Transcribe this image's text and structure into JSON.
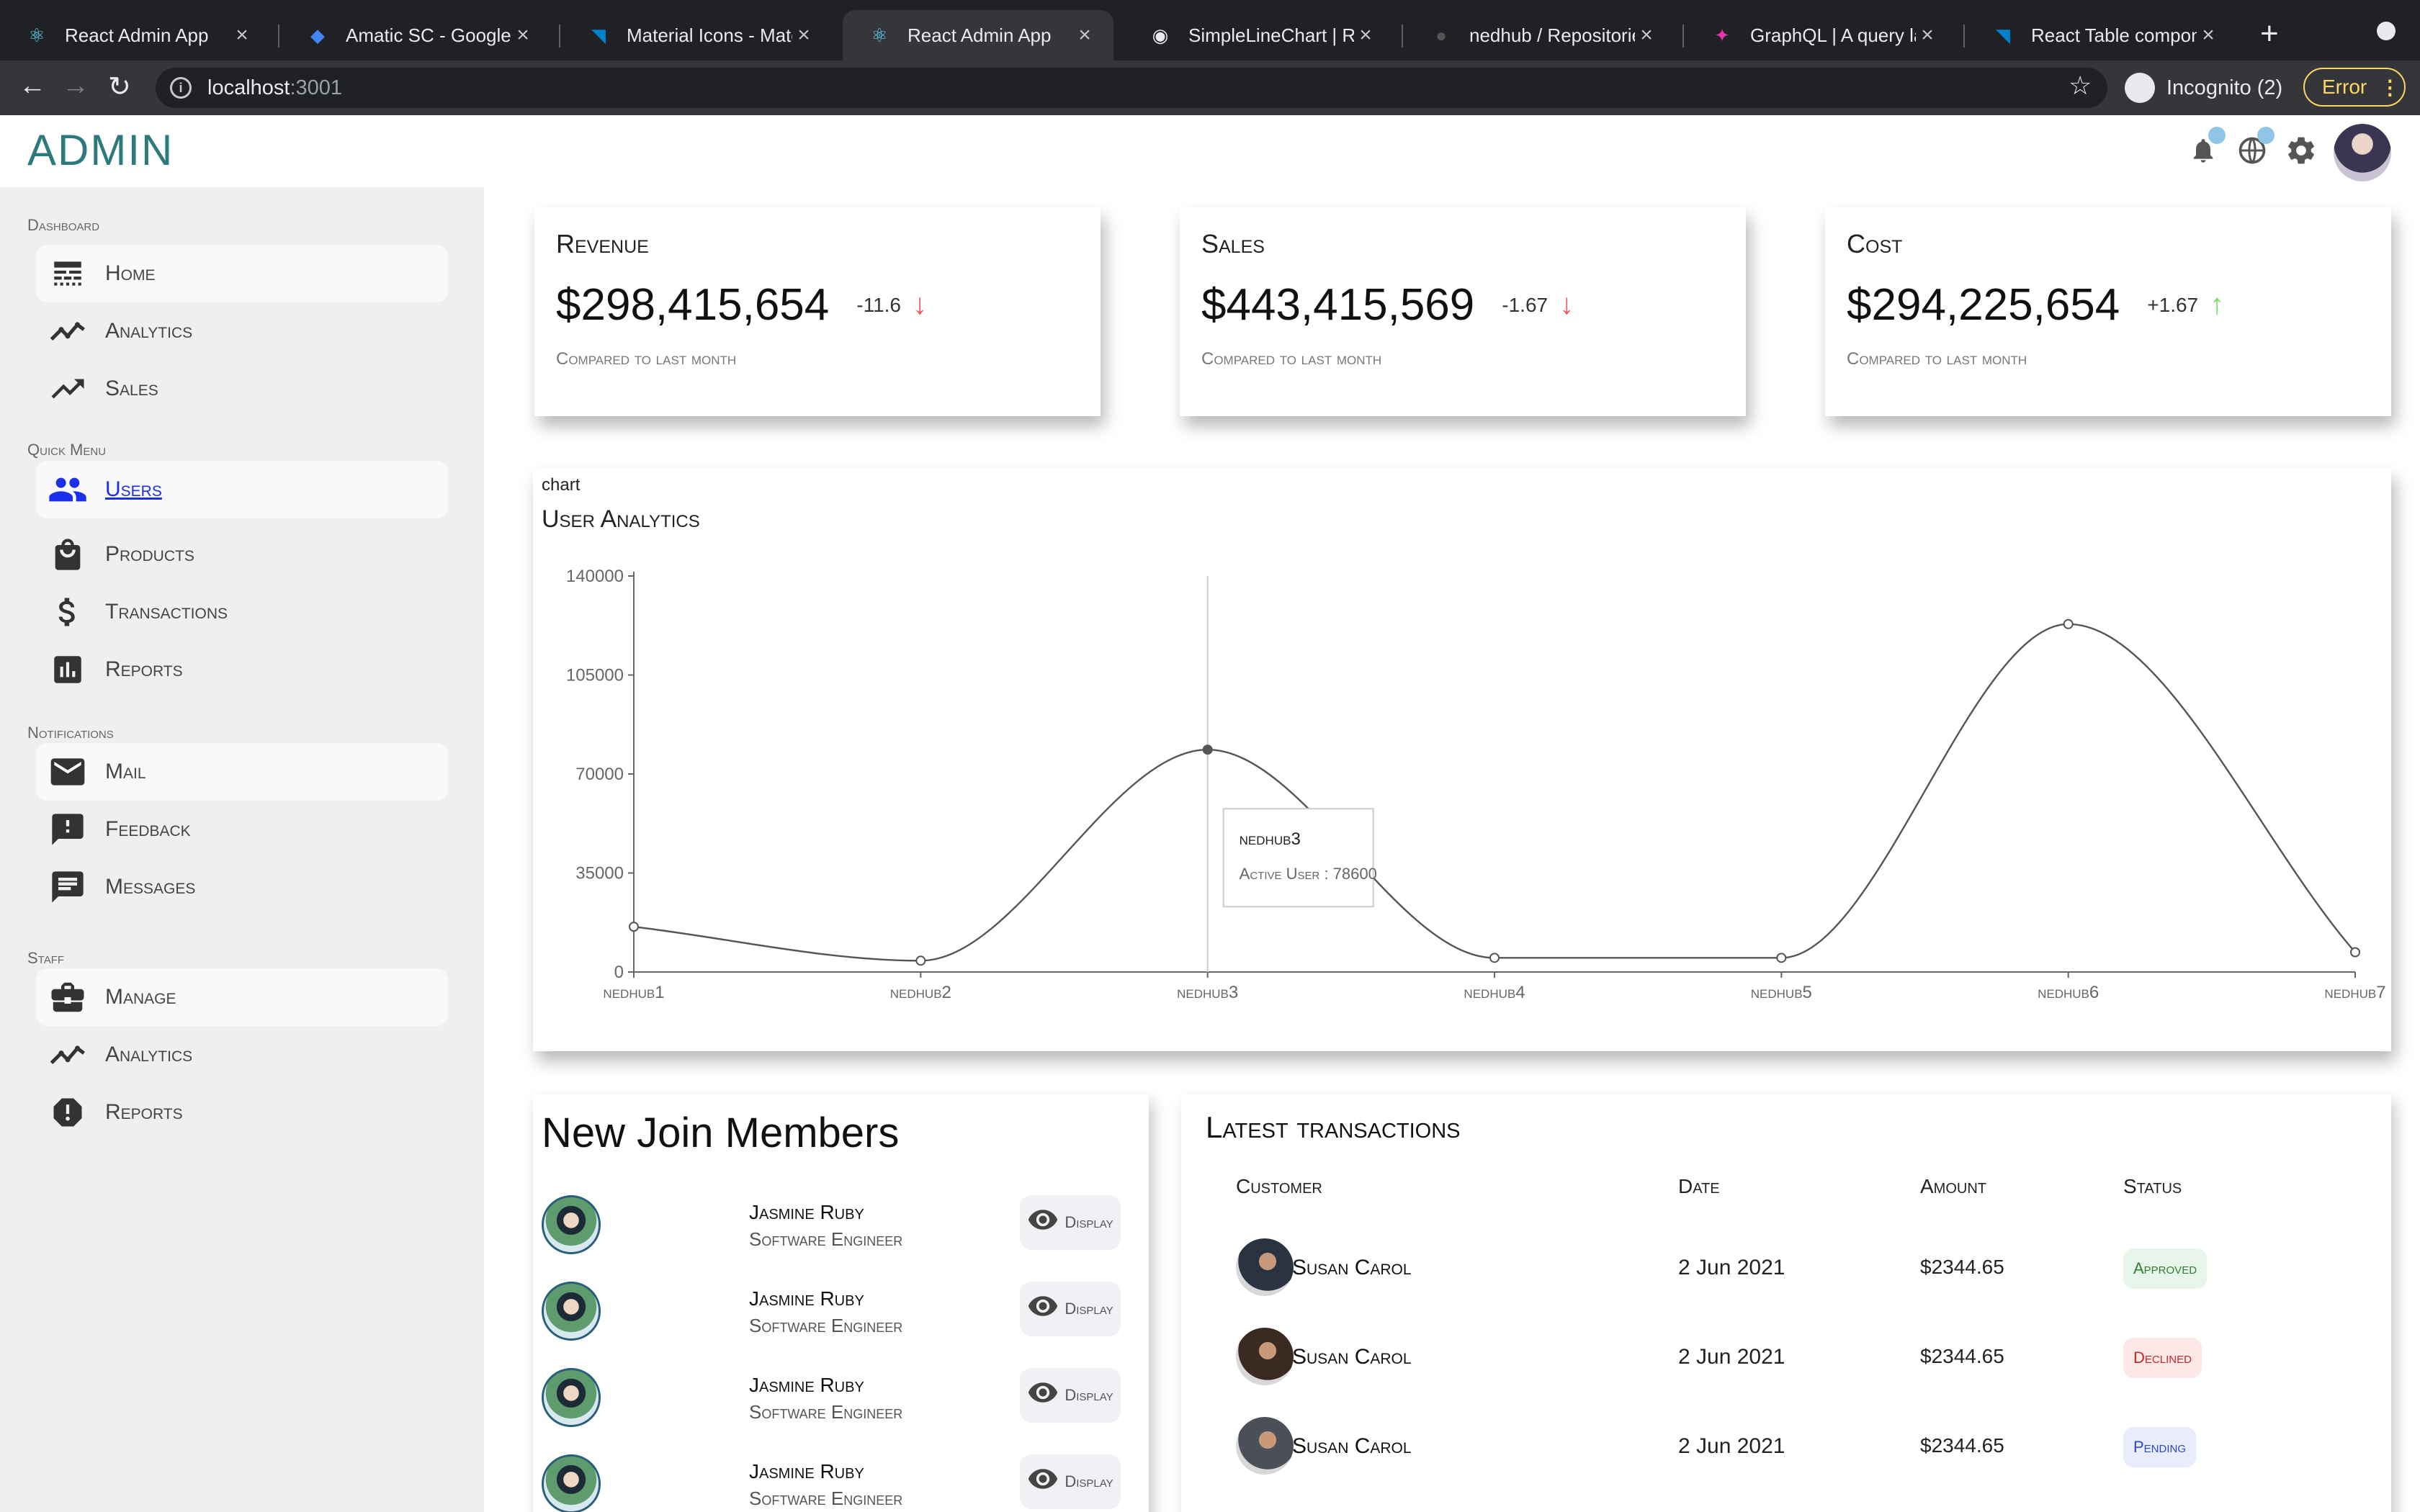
{
  "browser": {
    "tabs": [
      {
        "title": "React Admin App",
        "icon": "react-icon",
        "active": false
      },
      {
        "title": "Amatic SC - Google Fo",
        "icon": "google-fonts-icon",
        "active": false
      },
      {
        "title": "Material Icons - Materi",
        "icon": "mui-icon",
        "active": false
      },
      {
        "title": "React Admin App",
        "icon": "react-icon",
        "active": true
      },
      {
        "title": "SimpleLineChart | Rech",
        "icon": "globe-icon",
        "active": false
      },
      {
        "title": "nedhub / Repositories",
        "icon": "github-icon",
        "active": false
      },
      {
        "title": "GraphQL | A query lang",
        "icon": "graphql-icon",
        "active": false
      },
      {
        "title": "React Table componen",
        "icon": "mui-icon",
        "active": false
      }
    ],
    "url_host": "localhost",
    "url_port": ":3001",
    "profile_label": "Incognito (2)",
    "error_label": "Error"
  },
  "app": {
    "logo": "ADMIN"
  },
  "sidebar": {
    "sections": [
      {
        "title": "Dashboard",
        "items": [
          {
            "label": "Home",
            "icon": "line-style-icon",
            "highlight": true,
            "active": false
          },
          {
            "label": "Analytics",
            "icon": "timeline-icon",
            "highlight": false,
            "active": false
          },
          {
            "label": "Sales",
            "icon": "trending-up-icon",
            "highlight": false,
            "active": false
          }
        ]
      },
      {
        "title": "Quick Menu",
        "items": [
          {
            "label": "Users",
            "icon": "people-icon",
            "highlight": true,
            "active": true
          },
          {
            "label": "Products",
            "icon": "shopping-bag-icon",
            "highlight": false,
            "active": false
          },
          {
            "label": "Transactions",
            "icon": "dollar-icon",
            "highlight": false,
            "active": false
          },
          {
            "label": "Reports",
            "icon": "bar-chart-icon",
            "highlight": false,
            "active": false
          }
        ]
      },
      {
        "title": "Notifications",
        "items": [
          {
            "label": "Mail",
            "icon": "mail-icon",
            "highlight": true,
            "active": false
          },
          {
            "label": "Feedback",
            "icon": "feedback-icon",
            "highlight": false,
            "active": false
          },
          {
            "label": "Messages",
            "icon": "chat-icon",
            "highlight": false,
            "active": false
          }
        ]
      },
      {
        "title": "Staff",
        "items": [
          {
            "label": "Manage",
            "icon": "work-icon",
            "highlight": true,
            "active": false
          },
          {
            "label": "Analytics",
            "icon": "timeline-icon",
            "highlight": false,
            "active": false
          },
          {
            "label": "Reports",
            "icon": "report-icon",
            "highlight": false,
            "active": false
          }
        ]
      }
    ]
  },
  "featured": [
    {
      "title": "Revenue",
      "amount": "$298,415,654",
      "rate": "-11.6",
      "trend": "down",
      "sub": "Compared to last month"
    },
    {
      "title": "Sales",
      "amount": "$443,415,569",
      "rate": "-1.67",
      "trend": "down",
      "sub": "Compared to last month"
    },
    {
      "title": "Cost",
      "amount": "$294,225,654",
      "rate": "+1.67",
      "trend": "up",
      "sub": "Compared to last month"
    }
  ],
  "chart_section": {
    "label": "chart",
    "title": "User Analytics",
    "tooltip_name": "nedhub3",
    "tooltip_value": "Active User : 78600"
  },
  "chart_data": {
    "type": "line",
    "title": "User Analytics",
    "categories": [
      "nedhub1",
      "nedhub2",
      "nedhub3",
      "nedhub4",
      "nedhub5",
      "nedhub6",
      "nedhub7"
    ],
    "series": [
      {
        "name": "Active User",
        "values": [
          16000,
          4000,
          78600,
          5000,
          5000,
          123000,
          7000
        ]
      }
    ],
    "yticks": [
      "0",
      "35000",
      "70000",
      "105000",
      "140000"
    ],
    "ylim": [
      0,
      140000
    ],
    "grid": false,
    "curve": "monotone",
    "highlight_index": 2
  },
  "members": {
    "title": "New Join Members",
    "items": [
      {
        "name": "Jasmine Ruby",
        "job": "Software Engineer",
        "button": "Display"
      },
      {
        "name": "Jasmine Ruby",
        "job": "Software Engineer",
        "button": "Display"
      },
      {
        "name": "Jasmine Ruby",
        "job": "Software Engineer",
        "button": "Display"
      },
      {
        "name": "Jasmine Ruby",
        "job": "Software Engineer",
        "button": "Display"
      }
    ]
  },
  "transactions": {
    "title": "Latest transactions",
    "headers": {
      "customer": "Customer",
      "date": "Date",
      "amount": "Amount",
      "status": "Status"
    },
    "rows": [
      {
        "customer": "Susan Carol",
        "date": "2 Jun 2021",
        "amount": "$2344.65",
        "status": "Approved",
        "status_type": "approved",
        "avatar_color": "#2a3340"
      },
      {
        "customer": "Susan Carol",
        "date": "2 Jun 2021",
        "amount": "$2344.65",
        "status": "Declined",
        "status_type": "declined",
        "avatar_color": "#3a2a22"
      },
      {
        "customer": "Susan Carol",
        "date": "2 Jun 2021",
        "amount": "$2344.65",
        "status": "Pending",
        "status_type": "pending",
        "avatar_color": "#4a4f58"
      }
    ]
  }
}
